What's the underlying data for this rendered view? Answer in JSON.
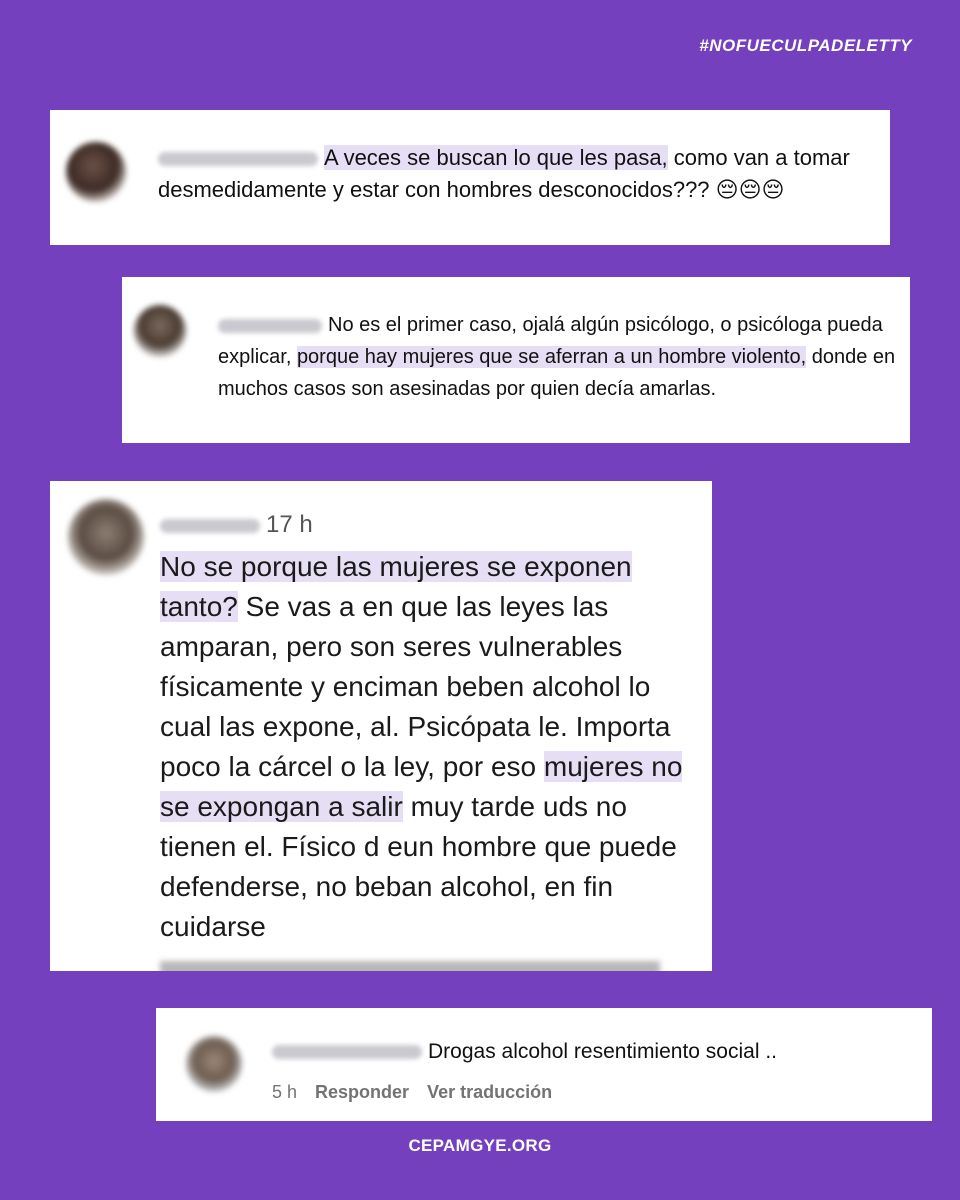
{
  "hashtag": "#NOFUECULPADELETTY",
  "footer": "CEPAMGYE.ORG",
  "comments": [
    {
      "text_pre": "",
      "highlight": "A veces se buscan lo que les pasa,",
      "text_post": " como van a tomar desmedidamente y estar con hombres desconocidos??? 😔😔😔"
    },
    {
      "text_pre": "No es el primer caso, ojalá algún psicólogo, o psicóloga pueda explicar, ",
      "highlight": "porque hay mujeres que se aferran a un hombre violento,",
      "text_post": " donde en muchos casos son asesinadas por quien decía amarlas."
    },
    {
      "time": "17 h",
      "highlight1": "No se porque las mujeres se exponen tanto?",
      "text_mid": " Se vas a en que las leyes las amparan, pero son seres vulnerables físicamente y enciman beben alcohol lo cual las expone, al. Psicópata le. Importa poco la cárcel o la ley, por eso ",
      "highlight2": "mujeres no se expongan a salir",
      "text_post": " muy tarde uds no tienen el. Físico d eun hombre que puede defenderse, no beban alcohol, en fin cuidarse"
    },
    {
      "text": "Drogas alcohol resentimiento social ..",
      "time": "5 h",
      "reply": "Responder",
      "translate": "Ver traducción"
    }
  ]
}
